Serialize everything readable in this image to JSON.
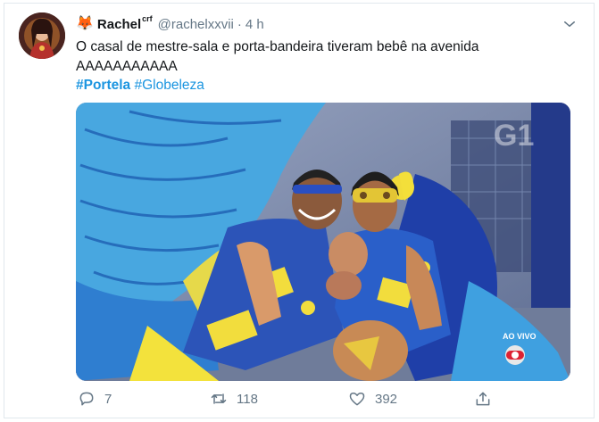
{
  "tweet": {
    "author_emoji": "🦊",
    "author_name": "Rachel",
    "author_name_suffix": "crf",
    "handle": "@rachelxxvii",
    "separator": "·",
    "time": "4 h",
    "text_line1": "O casal de mestre-sala e porta-bandeira tiveram bebê na avenida",
    "text_line2": "AAAAAAAAAAA",
    "hashtags": [
      "#Portela",
      "#Globeleza"
    ],
    "media": {
      "watermark": "G1",
      "live_label": "AO VIVO"
    }
  },
  "actions": {
    "reply_count": "7",
    "retweet_count": "118",
    "like_count": "392"
  },
  "icons": {
    "header": "chevron-down-icon",
    "reply": "reply-icon",
    "retweet": "retweet-icon",
    "like": "heart-icon",
    "share": "share-icon"
  },
  "colors": {
    "link": "#1b95e0",
    "secondary_text": "#657786",
    "primary_text": "#14171a",
    "border": "#e1e8ed"
  }
}
